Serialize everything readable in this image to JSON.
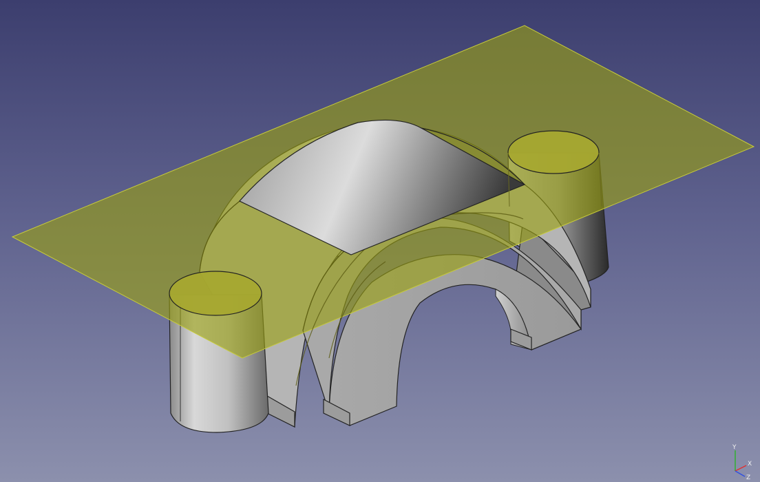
{
  "view": {
    "background_top": "#3c3e6e",
    "background_bottom": "#8c90ad",
    "plane_color": "#8d9426",
    "solid_color": "#bdbdbd"
  },
  "axes": {
    "x_label": "X",
    "y_label": "Y",
    "z_label": "Z",
    "x_color": "#e03030",
    "y_color": "#30b030",
    "z_color": "#3050e0"
  }
}
